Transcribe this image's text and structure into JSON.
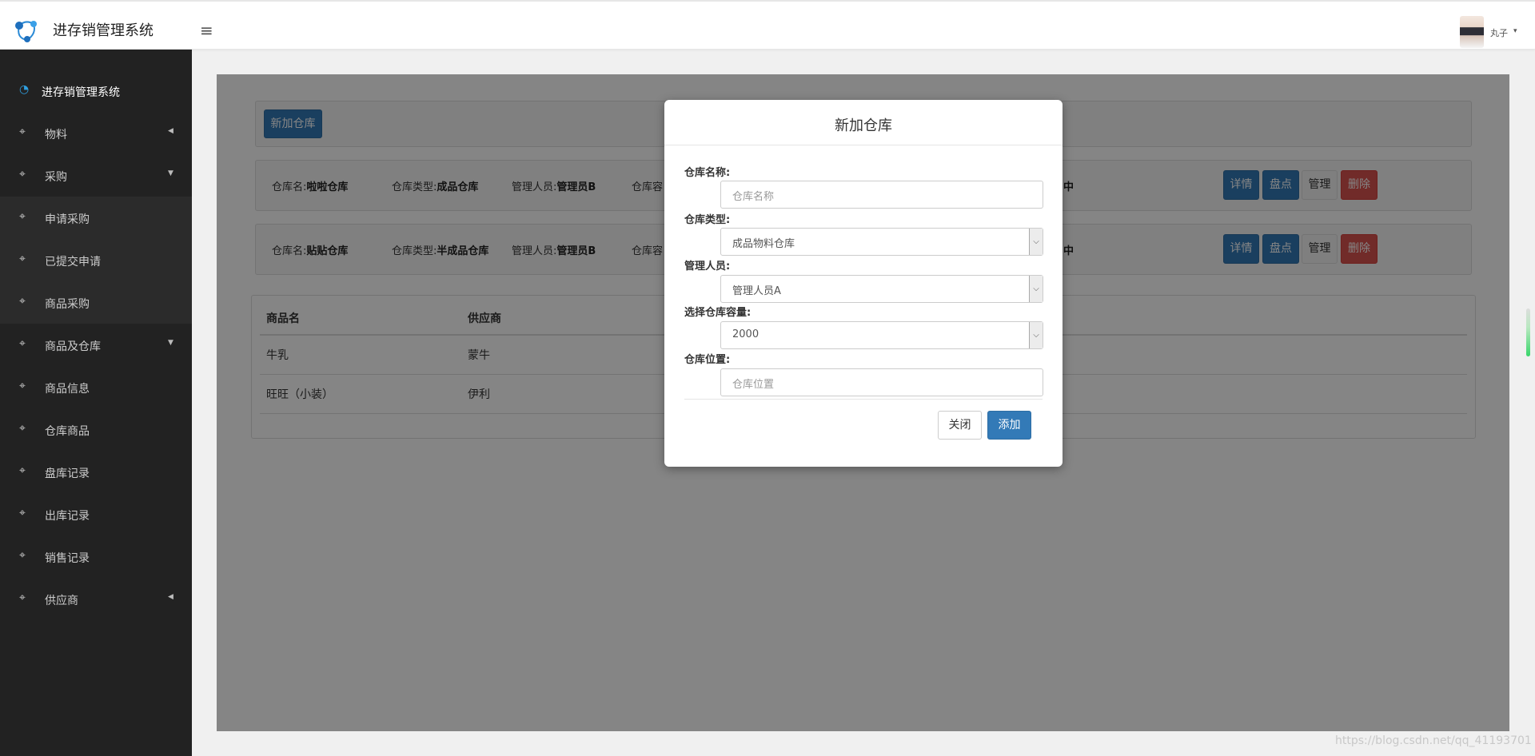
{
  "header": {
    "app_title": "进存销管理系统",
    "menu_toggle": "≡",
    "username": "丸子",
    "user_caret": "▾"
  },
  "sidebar": {
    "items": [
      {
        "icon": "dashboard-icon",
        "glyph": "◔",
        "label": "进存销管理系统",
        "arrow": ""
      },
      {
        "icon": "crosshair-icon",
        "glyph": "⌖",
        "label": "物料",
        "arrow": "◀"
      },
      {
        "icon": "crosshair-icon",
        "glyph": "⌖",
        "label": "采购",
        "arrow": "▼"
      },
      {
        "icon": "crosshair-icon",
        "glyph": "⌖",
        "label": "申请采购",
        "arrow": ""
      },
      {
        "icon": "crosshair-icon",
        "glyph": "⌖",
        "label": "已提交申请",
        "arrow": ""
      },
      {
        "icon": "crosshair-icon",
        "glyph": "⌖",
        "label": "商品采购",
        "arrow": ""
      },
      {
        "icon": "crosshair-icon",
        "glyph": "⌖",
        "label": "商品及仓库",
        "arrow": "▼"
      },
      {
        "icon": "crosshair-icon",
        "glyph": "⌖",
        "label": "商品信息",
        "arrow": ""
      },
      {
        "icon": "crosshair-icon",
        "glyph": "⌖",
        "label": "仓库商品",
        "arrow": ""
      },
      {
        "icon": "crosshair-icon",
        "glyph": "⌖",
        "label": "盘库记录",
        "arrow": ""
      },
      {
        "icon": "crosshair-icon",
        "glyph": "⌖",
        "label": "出库记录",
        "arrow": ""
      },
      {
        "icon": "crosshair-icon",
        "glyph": "⌖",
        "label": "销售记录",
        "arrow": ""
      },
      {
        "icon": "crosshair-icon",
        "glyph": "⌖",
        "label": "供应商",
        "arrow": "◀"
      }
    ]
  },
  "main": {
    "add_warehouse_button": "新加仓库",
    "warehouses": [
      {
        "name_label": "仓库名:",
        "name": "啦啦仓库",
        "type_label": "仓库类型:",
        "type": "成品仓库",
        "manager_label": "管理人员:",
        "manager": "管理员B",
        "capacity_label": "仓库容",
        "status_tail": "中"
      },
      {
        "name_label": "仓库名:",
        "name": "贴贴仓库",
        "type_label": "仓库类型:",
        "type": "半成品仓库",
        "manager_label": "管理人员:",
        "manager": "管理员B",
        "capacity_label": "仓库容",
        "status_tail": "中"
      }
    ],
    "row_actions": {
      "detail": "详情",
      "inventory": "盘点",
      "manage": "管理",
      "delete": "删除"
    },
    "goods_table": {
      "columns": [
        "商品名",
        "供应商"
      ],
      "rows": [
        [
          "牛乳",
          "蒙牛"
        ],
        [
          "旺旺（小装）",
          "伊利"
        ]
      ]
    }
  },
  "modal": {
    "title": "新加仓库",
    "fields": {
      "name": {
        "label": "仓库名称:",
        "placeholder": "仓库名称"
      },
      "type": {
        "label": "仓库类型:",
        "value": "成品物料仓库"
      },
      "manager": {
        "label": "管理人员:",
        "value": "管理人员A"
      },
      "capacity": {
        "label": "选择仓库容量:",
        "value": "2000"
      },
      "location": {
        "label": "仓库位置:",
        "placeholder": "仓库位置"
      }
    },
    "close_button": "关闭",
    "add_button": "添加"
  },
  "watermark": "https://blog.csdn.net/qq_41193701",
  "colors": {
    "sidebar_bg": "#222222",
    "primary": "#337ab7",
    "danger": "#d9534f",
    "home_icon": "#2f9fe0"
  }
}
